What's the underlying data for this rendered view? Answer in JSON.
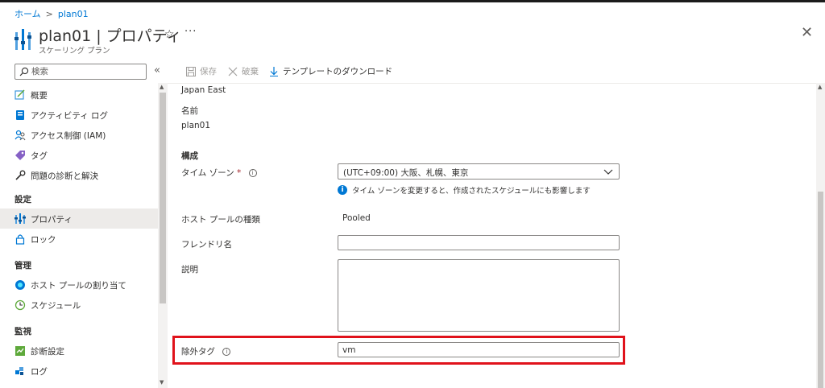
{
  "breadcrumb": {
    "home": "ホーム",
    "separator": ">",
    "current": "plan01"
  },
  "header": {
    "title": "plan01 | プロパティ",
    "subtitle": "スケーリング プラン",
    "favorite_icon": "☆",
    "more_icon": "···",
    "close_icon": "✕"
  },
  "search": {
    "placeholder": "検索",
    "collapse_icon": "«"
  },
  "sidebar": {
    "items": [
      {
        "label": "概要",
        "icon": "overview-icon"
      },
      {
        "label": "アクティビティ ログ",
        "icon": "activity-log-icon"
      },
      {
        "label": "アクセス制御 (IAM)",
        "icon": "iam-icon"
      },
      {
        "label": "タグ",
        "icon": "tag-icon"
      },
      {
        "label": "問題の診断と解決",
        "icon": "wrench-icon"
      }
    ],
    "group_settings": "設定",
    "settings_items": [
      {
        "label": "プロパティ",
        "icon": "properties-icon",
        "active": true
      },
      {
        "label": "ロック",
        "icon": "lock-icon"
      }
    ],
    "group_manage": "管理",
    "manage_items": [
      {
        "label": "ホスト プールの割り当て",
        "icon": "host-pool-icon"
      },
      {
        "label": "スケジュール",
        "icon": "clock-icon"
      }
    ],
    "group_monitor": "監視",
    "monitor_items": [
      {
        "label": "診断設定",
        "icon": "diagnostic-settings-icon"
      },
      {
        "label": "ログ",
        "icon": "logs-icon"
      }
    ]
  },
  "toolbar": {
    "save_label": "保存",
    "discard_label": "破棄",
    "download_label": "テンプレートのダウンロード"
  },
  "form": {
    "location_value": "Japan East",
    "name_label": "名前",
    "name_value": "plan01",
    "section_config": "構成",
    "timezone_label": "タイム ゾーン",
    "required_mark": "*",
    "timezone_value": "(UTC+09:00) 大阪、札幌、東京",
    "timezone_hint": "タイム ゾーンを変更すると、作成されたスケジュールにも影響します",
    "hostpool_type_label": "ホスト プールの種類",
    "hostpool_type_value": "Pooled",
    "friendly_name_label": "フレンドリ名",
    "friendly_name_value": "",
    "description_label": "説明",
    "description_value": "",
    "exclusion_tag_label": "除外タグ",
    "exclusion_tag_value": "vm"
  },
  "colors": {
    "accent": "#0078d4",
    "highlight": "#e0121b",
    "active_bg": "#edebe9"
  }
}
